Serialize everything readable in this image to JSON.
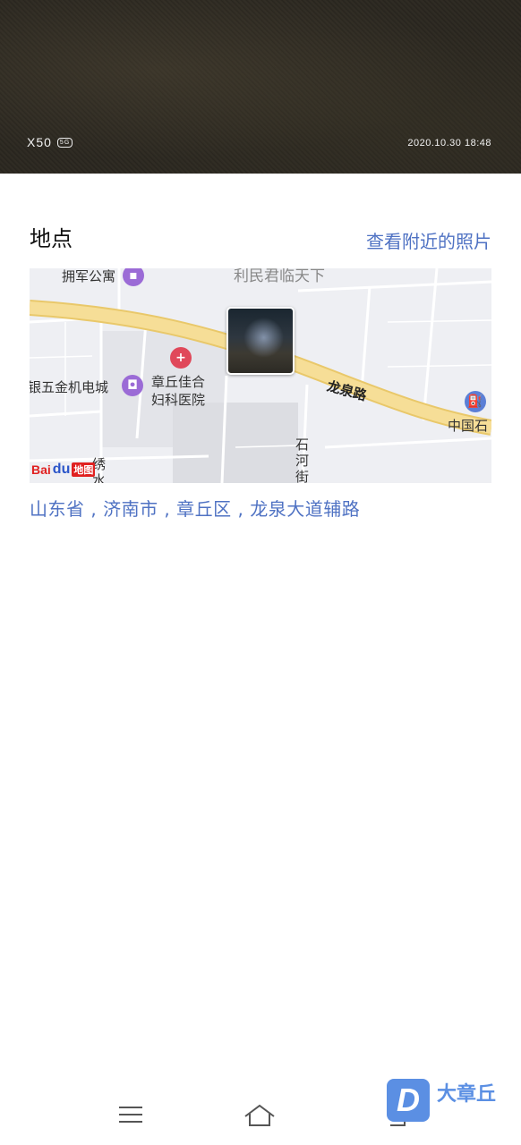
{
  "photo": {
    "device_mark": "X50",
    "network_badge": "5G",
    "timestamp": "2020.10.30 18:48"
  },
  "location_section": {
    "title": "地点",
    "nearby_link": "查看附近的照片"
  },
  "map": {
    "labels": {
      "apartment": "拥军公寓",
      "building_top": "利民君临天下",
      "hardware_mall": "银五金机电城",
      "hospital_line1": "章丘佳合",
      "hospital_line2": "妇科医院",
      "road": "龙泉路",
      "gas_station": "中国石",
      "street_char1": "石",
      "street_char2": "河",
      "street_char3": "街",
      "street2_char1": "绣",
      "street2_char2": "水"
    },
    "logo": {
      "bai": "Bai",
      "paw": "du",
      "map_text": "地图"
    }
  },
  "address": "山东省 , 济南市 , 章丘区 , 龙泉大道辅路",
  "brand": {
    "logo_letter": "D",
    "name": "大章丘"
  },
  "colors": {
    "accent": "#4f72c3",
    "road": "#f3d98a",
    "hospital": "#e0485a",
    "shop": "#9b6bd6",
    "gas": "#5b7fd6"
  }
}
